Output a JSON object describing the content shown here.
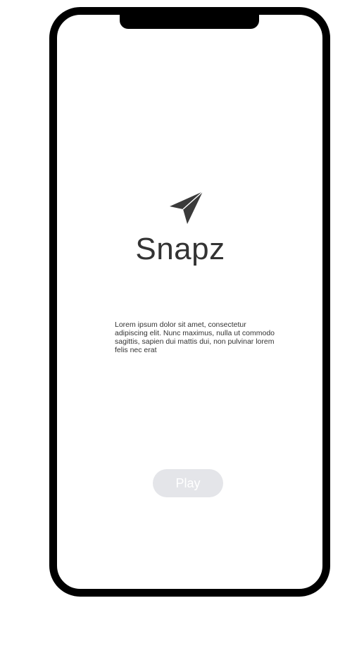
{
  "app": {
    "title": "Snapz",
    "logo_icon": "paper-plane-icon",
    "description": "Lorem ipsum dolor sit amet, consectetur adipiscing elit. Nunc maximus, nulla ut commodo sagittis, sapien dui mattis dui, non pulvinar lorem felis nec erat"
  },
  "actions": {
    "play_label": "Play"
  },
  "colors": {
    "frame": "#000000",
    "text": "#333333",
    "button_bg": "#e4e5e9",
    "button_text": "#ffffff"
  }
}
